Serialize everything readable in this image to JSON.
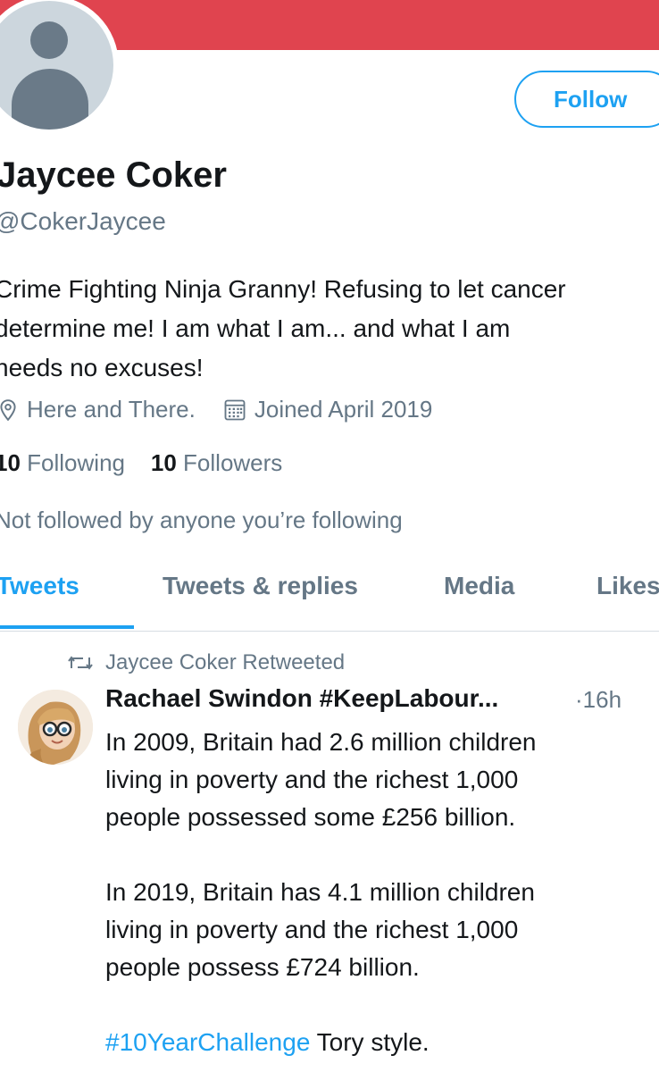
{
  "profile": {
    "name": "Jaycee Coker",
    "handle": "@CokerJaycee",
    "follow_label": "Follow",
    "bio_lines": [
      "Crime Fighting Ninja Granny! Refusing to let cancer",
      "determine me! I am what I am... and what I am",
      "needs no excuses!"
    ],
    "location": "Here and There.",
    "joined": "Joined April 2019",
    "following_count": "10",
    "following_label": "Following",
    "followers_count": "10",
    "followers_label": "Followers",
    "not_followed": "Not followed by anyone you’re following"
  },
  "tabs": [
    "Tweets",
    "Tweets & replies",
    "Media",
    "Likes"
  ],
  "tweet": {
    "retweet_label": "Jaycee Coker Retweeted",
    "author": "Rachael Swindon #KeepLabour...",
    "time": "·16h",
    "paragraph1": [
      "In 2009, Britain had 2.6 million children",
      "living in poverty and the richest 1,000",
      "people possessed some £256 billion."
    ],
    "paragraph2": [
      "In 2019, Britain has 4.1 million children",
      "living in poverty and the richest 1,000",
      "people possess £724 billion."
    ],
    "hashtag": "#10YearChallenge",
    "tail": " Tory style."
  },
  "colors": {
    "banner": "#e0444f",
    "accent": "#1da1f2",
    "secondary_text": "#657786"
  }
}
